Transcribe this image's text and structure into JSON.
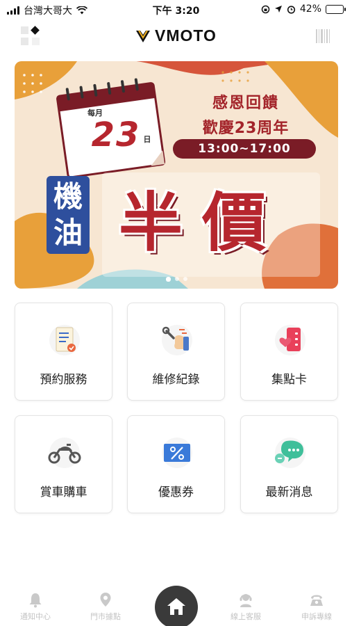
{
  "status_bar": {
    "carrier": "台灣大哥大",
    "time": "下午 3:20",
    "battery": "42%",
    "battery_level": 0.42
  },
  "header": {
    "brand": "VMOTO"
  },
  "banner": {
    "calendar_month": "每月",
    "calendar_day": "23",
    "calendar_suffix": "日",
    "line1": "感恩回饋",
    "line2": "歡慶23周年",
    "time_range": "13:00~17:00",
    "product": "機油",
    "headline": "半價",
    "slides": 3,
    "active_slide": 1
  },
  "tiles": [
    {
      "label": "預約服務",
      "icon": "appointment-icon"
    },
    {
      "label": "維修紀錄",
      "icon": "repair-record-icon"
    },
    {
      "label": "集點卡",
      "icon": "point-card-icon"
    },
    {
      "label": "賞車購車",
      "icon": "motorcycle-icon"
    },
    {
      "label": "優惠券",
      "icon": "coupon-icon"
    },
    {
      "label": "最新消息",
      "icon": "news-icon"
    }
  ],
  "bottom_nav": [
    {
      "label": "通知中心",
      "icon": "bell-icon"
    },
    {
      "label": "門市據點",
      "icon": "location-pin-icon"
    },
    {
      "label": "",
      "icon": "home-icon"
    },
    {
      "label": "線上客服",
      "icon": "customer-service-icon"
    },
    {
      "label": "申訴專線",
      "icon": "complaint-line-icon"
    }
  ],
  "colors": {
    "accent_red": "#b6262e",
    "banner_blue": "#2e4f9d",
    "home_button": "#3a3a3a",
    "nav_inactive": "#c4c4c4"
  }
}
